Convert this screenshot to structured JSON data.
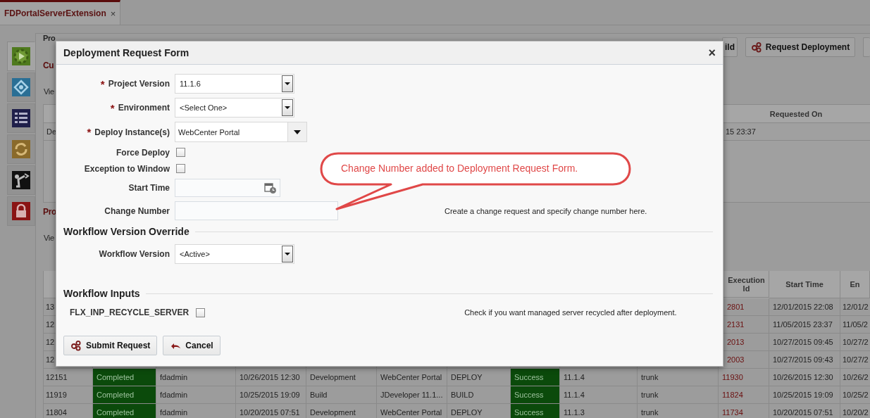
{
  "tabs": [
    {
      "label": "FDPortalServerExtension",
      "close": "×",
      "selected": true
    }
  ],
  "sidebar": {
    "items": [
      {
        "kind": "deploy",
        "selected": true
      },
      {
        "kind": "network",
        "selected": false
      },
      {
        "kind": "list",
        "selected": false
      },
      {
        "kind": "refresh",
        "selected": false
      },
      {
        "kind": "robot",
        "selected": false
      },
      {
        "kind": "lock",
        "selected": false
      }
    ]
  },
  "page": {
    "title_fragment": "Pro",
    "section_fragment": "Cu",
    "view_fragment": "Vie",
    "toolbar": [
      {
        "kind": "partial",
        "label": "ild"
      },
      {
        "kind": "request",
        "label": "Request Deployment"
      },
      {
        "kind": "edge"
      }
    ],
    "table_1": {
      "header": "Requested On",
      "row": {
        "cell_1": "De",
        "cell_2": "15 23:37"
      }
    },
    "section_2_fragment": "Pro",
    "view_2_fragment": "Vie",
    "table_2": {
      "columns": [
        "Execution Id",
        "Start Time",
        "En"
      ],
      "rows": [
        {
          "kind": "covered",
          "id": "13",
          "execution_id": "2801",
          "start_time": "12/01/2015 22:08",
          "end_time": "12/01/2"
        },
        {
          "kind": "covered",
          "id": "12",
          "execution_id": "2131",
          "start_time": "11/05/2015 23:37",
          "end_time": "11/05/2"
        },
        {
          "kind": "covered",
          "id": "12",
          "execution_id": "2013",
          "start_time": "10/27/2015 09:45",
          "end_time": "10/27/2"
        },
        {
          "kind": "covered",
          "id": "12",
          "execution_id": "2003",
          "start_time": "10/27/2015 09:43",
          "end_time": "10/27/2"
        },
        {
          "kind": "full",
          "cells": [
            "12151",
            "Completed",
            "fdadmin",
            "10/26/2015 12:30",
            "Development",
            "WebCenter Portal",
            "DEPLOY",
            "Success",
            "11.1.4",
            "trunk",
            "11930",
            "10/26/2015 12:30",
            "10/26/2"
          ]
        },
        {
          "kind": "full",
          "cells": [
            "11919",
            "Completed",
            "fdadmin",
            "10/25/2015 19:09",
            "Build",
            "JDeveloper 11.1...",
            "BUILD",
            "Success",
            "11.1.4",
            "trunk",
            "11824",
            "10/25/2015 19:09",
            "10/25/2"
          ]
        },
        {
          "kind": "full",
          "cells": [
            "11804",
            "Completed",
            "fdadmin",
            "10/20/2015 07:51",
            "Development",
            "WebCenter Portal",
            "DEPLOY",
            "Success",
            "11.1.3",
            "trunk",
            "11734",
            "10/20/2015 07:51",
            "10/20/2"
          ]
        }
      ]
    }
  },
  "dialog": {
    "title": "Deployment Request Form",
    "close": "×",
    "fields": [
      {
        "kind": "select",
        "mark": "*",
        "label": "Project Version",
        "value": "11.1.6"
      },
      {
        "kind": "select",
        "mark": "*",
        "label": "Environment",
        "value": "<Select One>"
      },
      {
        "kind": "combo",
        "mark": "*",
        "label": "Deploy Instance(s)",
        "value": "WebCenter Portal"
      },
      {
        "kind": "checkbox",
        "label": "Force Deploy",
        "checked": false
      },
      {
        "kind": "checkbox",
        "label": "Exception to Window",
        "checked": false
      },
      {
        "kind": "datetime",
        "label": "Start Time"
      },
      {
        "kind": "text",
        "label": "Change Number",
        "hint": "Create a change request and specify change number here."
      }
    ],
    "sections": [
      {
        "title": "Workflow Version Override",
        "fields": [
          {
            "kind": "select",
            "label": "Workflow Version",
            "value": "<Active>"
          }
        ]
      },
      {
        "title": "Workflow Inputs",
        "fields": [
          {
            "kind": "input_checkbox",
            "label": "FLX_INP_RECYCLE_SERVER",
            "checked": false,
            "hint": "Check if you want managed server recycled after deployment."
          }
        ]
      }
    ],
    "buttons": [
      {
        "kind": "submit",
        "label": "Submit Request"
      },
      {
        "kind": "cancel",
        "label": "Cancel"
      }
    ]
  },
  "callout": {
    "text": "Change Number added to Deployment Request Form."
  }
}
